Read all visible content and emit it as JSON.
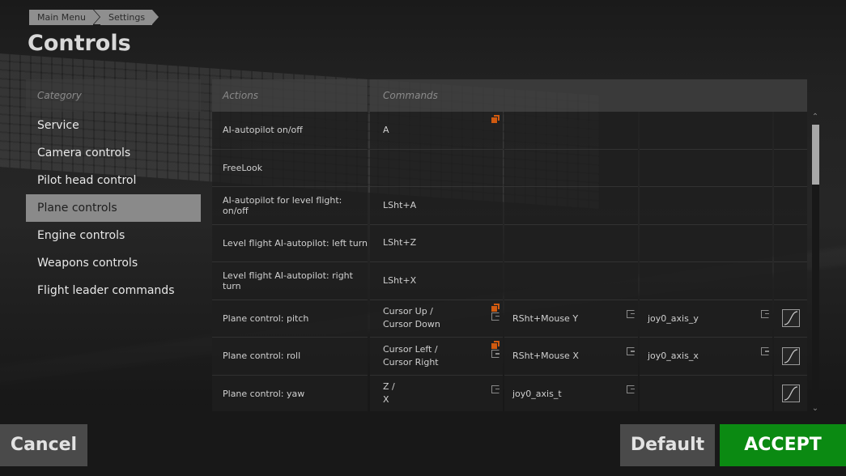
{
  "breadcrumb": [
    "Main Menu",
    "Settings"
  ],
  "page_title": "Controls",
  "category": {
    "header": "Category",
    "items": [
      "Service",
      "Camera controls",
      "Pilot head control",
      "Plane controls",
      "Engine controls",
      "Weapons controls",
      "Flight leader commands"
    ],
    "selected": "Plane controls"
  },
  "table": {
    "headers": {
      "actions": "Actions",
      "commands": "Commands"
    },
    "rows": [
      {
        "action": "AI-autopilot on/off",
        "key1": "A",
        "key2": "",
        "key3": "",
        "curve": false
      },
      {
        "action": "FreeLook",
        "key1": "",
        "key2": "",
        "key3": "",
        "curve": false
      },
      {
        "action": "AI-autopilot for level flight: on/off",
        "key1": "LSht+A",
        "key2": "",
        "key3": "",
        "curve": false
      },
      {
        "action": "Level flight AI-autopilot: left turn",
        "key1": "LSht+Z",
        "key2": "",
        "key3": "",
        "curve": false
      },
      {
        "action": "Level flight AI-autopilot: right turn",
        "key1": "LSht+X",
        "key2": "",
        "key3": "",
        "curve": false
      },
      {
        "action": "Plane control: pitch",
        "key1": "Cursor Up /\nCursor Down",
        "key2": "RSht+Mouse Y",
        "key3": "joy0_axis_y",
        "curve": true
      },
      {
        "action": "Plane control: roll",
        "key1": "Cursor Left /\nCursor Right",
        "key2": "RSht+Mouse X",
        "key3": "joy0_axis_x",
        "curve": true
      },
      {
        "action": "Plane control: yaw",
        "key1": "Z /\nX",
        "key2": "joy0_axis_t",
        "key3": "",
        "curve": true
      }
    ]
  },
  "buttons": {
    "cancel": "Cancel",
    "default": "Default",
    "accept": "ACCEPT"
  },
  "colors": {
    "accept": "#0b8a12",
    "selected": "#8a8a8a",
    "orange_marker": "#d05a10"
  }
}
